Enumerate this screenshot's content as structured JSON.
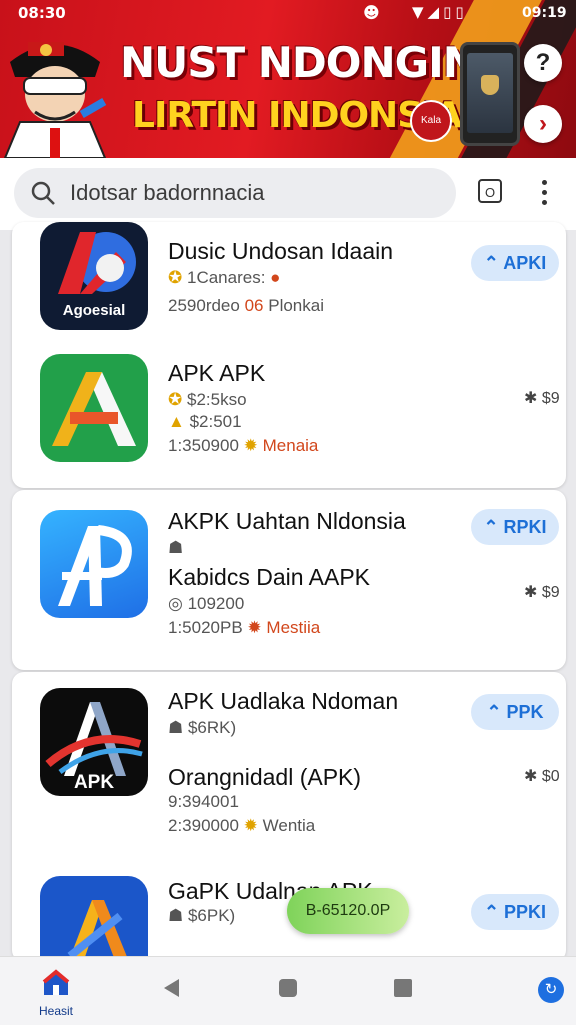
{
  "status_bar": {
    "time_left": "08:30",
    "time_right": "09:19",
    "signal_icons": "▼◢▯▯"
  },
  "banner": {
    "title_line1": "NUST NDONGIN",
    "title_line2": "LIRTIN INDONSIA",
    "badge": "Kala",
    "help_icon": "?",
    "next_icon": "›"
  },
  "search": {
    "text": "Idotsar badornnacia",
    "camera_icon": "O"
  },
  "apps": [
    {
      "title": "Dusic Undosan Idaain",
      "line1": "1Canares:",
      "line2_a": "2590rdeo",
      "line2_b": "06",
      "line2_c": "Plonkai",
      "button": "APKI",
      "icon_label": "Agoesial"
    },
    {
      "title": "APK APK",
      "line1": "$2:5kso",
      "line2": "$2:501",
      "line3_a": "1:350900",
      "line3_b": "Menaia",
      "price": "$9"
    },
    {
      "title": "AKPK Uahtan Nldonsia",
      "subtitle": "Kabidcs Dain AAPK",
      "line1": "109200",
      "line2_a": "1:5020PB",
      "line2_b": "Mestiia",
      "button": "RPKI",
      "price": "$9"
    },
    {
      "title": "APK Uadlaka Ndoman",
      "line0": "$6RK)",
      "subtitle": "Orangnidadl (APK)",
      "line1": "9:394001",
      "line2_a": "2:390000",
      "line2_b": "Wentia",
      "button": "PPK",
      "price": "$0",
      "icon_label": "APK"
    },
    {
      "title": "GaPK Udalnan APK",
      "line0": "$6PK)",
      "button": "PPKI"
    }
  ],
  "toast": "B-65120.0P",
  "bottom_nav": {
    "home_label": "Heasit",
    "assist_icon": "↻"
  },
  "colors": {
    "brand_red": "#e21b22",
    "accent_blue": "#1d6fd6",
    "banner_yellow": "#ffd21f"
  }
}
